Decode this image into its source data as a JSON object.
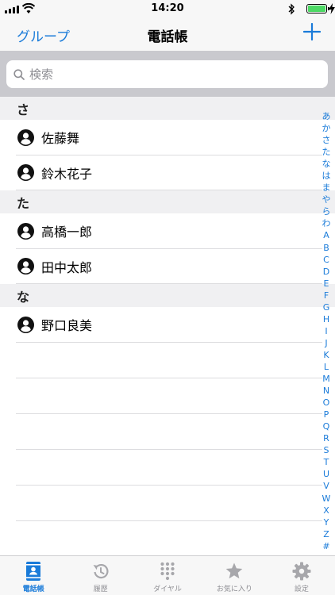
{
  "status_bar": {
    "time": "14:20"
  },
  "nav": {
    "back_label": "グループ",
    "title": "電話帳",
    "add_icon": "plus-icon"
  },
  "search": {
    "placeholder": "検索"
  },
  "sections": [
    {
      "header": "さ",
      "contacts": [
        "佐藤舞",
        "鈴木花子"
      ]
    },
    {
      "header": "た",
      "contacts": [
        "高橋一郎",
        "田中太郎"
      ]
    },
    {
      "header": "な",
      "contacts": [
        "野口良美"
      ]
    }
  ],
  "index_letters": [
    "あ",
    "か",
    "さ",
    "た",
    "な",
    "は",
    "ま",
    "や",
    "ら",
    "わ",
    "A",
    "B",
    "C",
    "D",
    "E",
    "F",
    "G",
    "H",
    "I",
    "J",
    "K",
    "L",
    "M",
    "N",
    "O",
    "P",
    "Q",
    "R",
    "S",
    "T",
    "U",
    "V",
    "W",
    "X",
    "Y",
    "Z",
    "#"
  ],
  "tabs": [
    {
      "label": "電話帳",
      "icon": "contacts-icon",
      "active": true
    },
    {
      "label": "履歴",
      "icon": "history-icon",
      "active": false
    },
    {
      "label": "ダイヤル",
      "icon": "keypad-icon",
      "active": false
    },
    {
      "label": "お気に入り",
      "icon": "star-icon",
      "active": false
    },
    {
      "label": "設定",
      "icon": "gear-icon",
      "active": false
    }
  ],
  "colors": {
    "accent": "#1a7bd9",
    "inactive": "#a7a7ab",
    "battery": "#4cd964"
  }
}
